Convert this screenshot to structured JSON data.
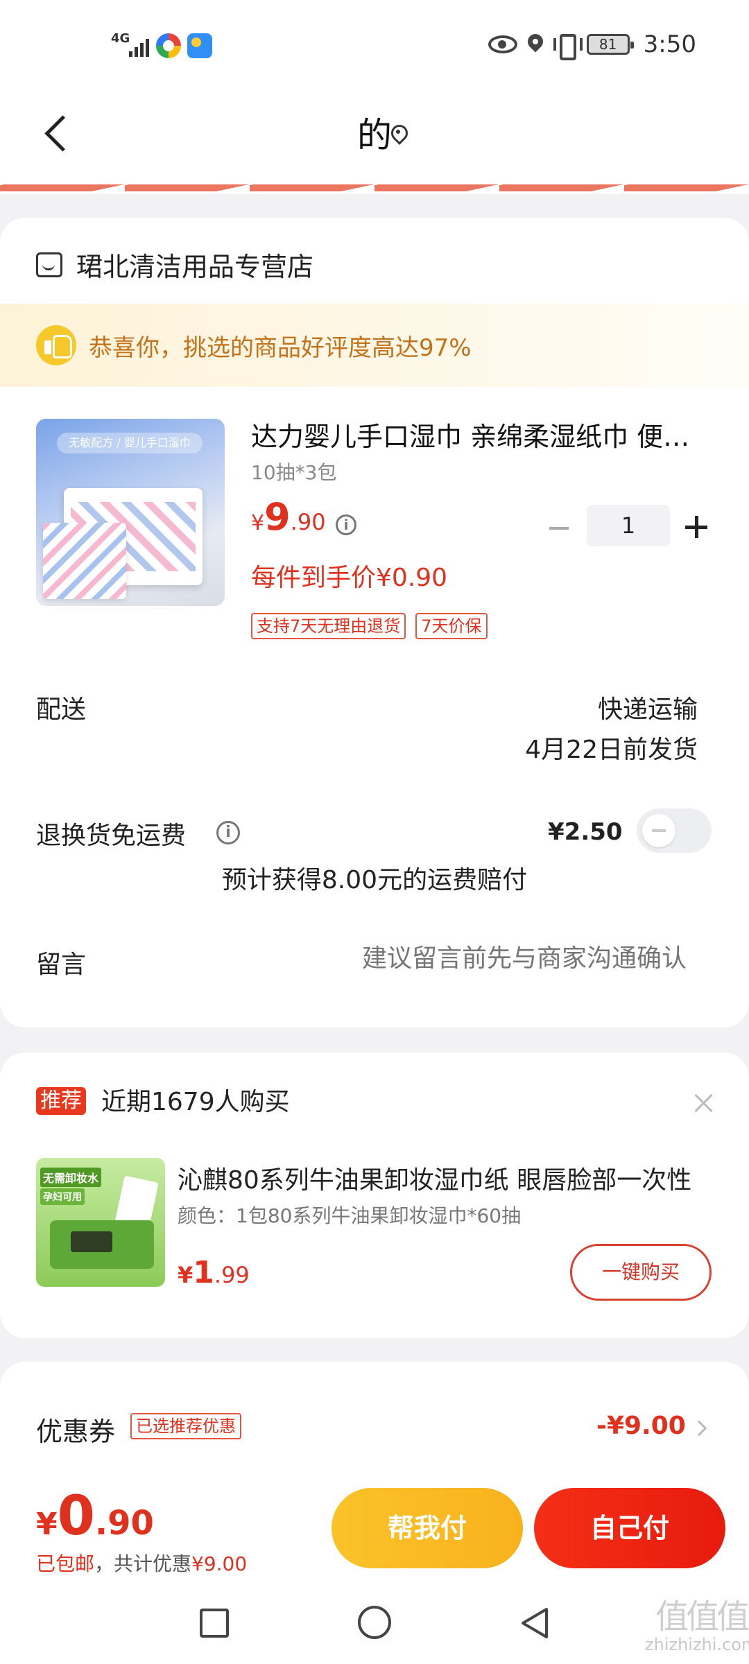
{
  "status_bar": {
    "network": "4G",
    "battery": "81",
    "time": "3:50"
  },
  "header": {
    "title": "的"
  },
  "order": {
    "store_name": "珺北清洁用品专营店",
    "praise_text": "恭喜你，挑选的商品好评度高达97%",
    "product": {
      "image_text": "无敏配方 / 婴儿手口湿巾",
      "title": "达力婴儿手口湿巾 亲绵柔湿纸巾 便携装",
      "spec": "10抽*3包",
      "price_symbol": "¥",
      "price_int": "9",
      "price_dec": ".90",
      "quantity": "1",
      "net_price": "每件到手价¥0.90",
      "tags": [
        "支持7天无理由退货",
        "7天价保"
      ]
    },
    "delivery": {
      "label": "配送",
      "method": "快递运输",
      "date": "4月22日前发货"
    },
    "return_shipping": {
      "label": "退换货免运费",
      "price": "¥2.50",
      "toggle_on": false,
      "compensation": "预计获得8.00元的运费赔付"
    },
    "message": {
      "label": "留言",
      "placeholder": "建议留言前先与商家沟通确认"
    }
  },
  "recommend": {
    "badge": "推荐",
    "title": "近期1679人购买",
    "image_tags": [
      "无需卸妆水",
      "孕妇可用"
    ],
    "product_name": "沁麒80系列牛油果卸妆湿巾纸 眼唇脸部一次性",
    "spec": "颜色：1包80系列牛油果卸妆湿巾*60抽",
    "price_symbol": "¥",
    "price_int": "1",
    "price_dec": ".99",
    "buy_label": "一键购买"
  },
  "coupon": {
    "label": "优惠券",
    "tag": "已选推荐优惠",
    "amount": "-¥9.00"
  },
  "pay_bar": {
    "price_symbol": "¥",
    "price_int": "0",
    "price_dec": ".90",
    "shipping_note": "已包邮",
    "discount_note": "，共计优惠",
    "discount_amount": "¥9.00",
    "help_pay_label": "帮我付",
    "self_pay_label": "自己付"
  },
  "watermark": {
    "glyph": "值值值",
    "site": "zhizhizhi.com"
  },
  "colors": {
    "accent_red": "#e0301e",
    "help_yellow": "#fbc22a",
    "praise_orange": "#c4721a"
  }
}
